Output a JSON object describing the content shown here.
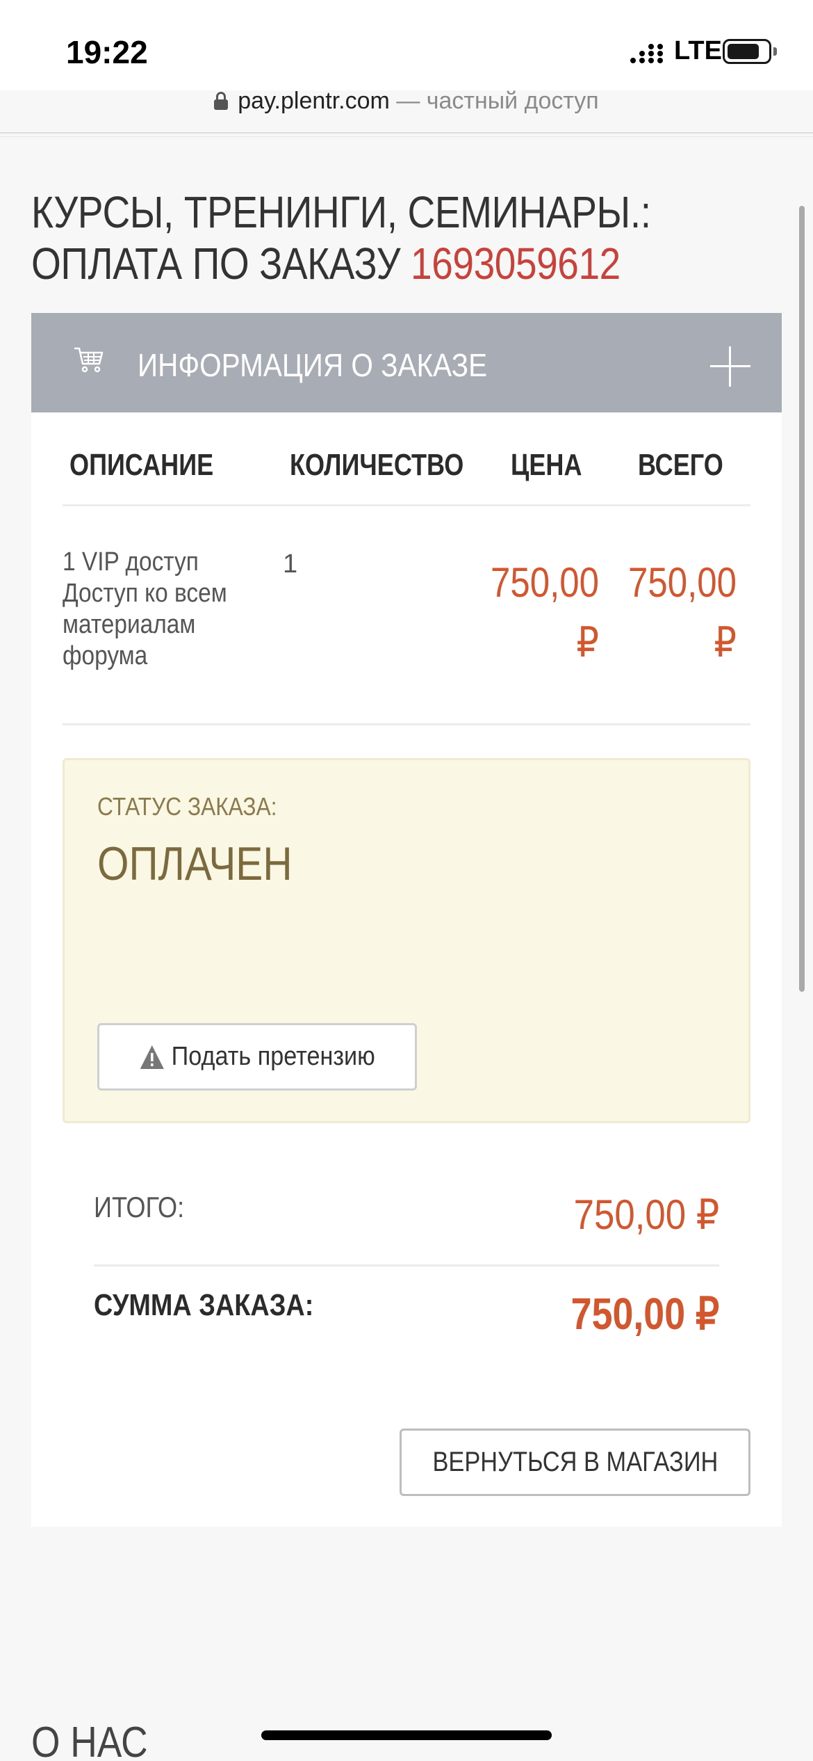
{
  "status_bar": {
    "time": "19:22",
    "network": "LTE",
    "battery_level": 0.8
  },
  "browser": {
    "domain": "pay.plentr.com",
    "privacy": "— частный доступ"
  },
  "page": {
    "title_line1": "КУРСЫ, ТРЕНИНГИ, СЕМИНАРЫ.:",
    "title_line2_prefix": "ОПЛАТА ПО ЗАКАЗУ ",
    "order_number": "1693059612"
  },
  "order_info": {
    "header": "ИНФОРМАЦИЯ О ЗАКАЗЕ",
    "columns": {
      "description": "ОПИСАНИЕ",
      "quantity": "КОЛИЧЕСТВО",
      "price": "ЦЕНА",
      "total": "ВСЕГО"
    },
    "item": {
      "description": "1 VIP доступ Доступ ко всем материалам форума",
      "quantity": "1",
      "price": "750,00 ₽",
      "total": "750,00 ₽"
    }
  },
  "status": {
    "label": "СТАТУС ЗАКАЗА:",
    "value": "ОПЛАЧЕН",
    "claim_button": "Подать претензию"
  },
  "totals": {
    "subtotal_label": "ИТОГО:",
    "subtotal_value": "750,00 ₽",
    "sum_label": "СУММА ЗАКАЗА:",
    "sum_value": "750,00 ₽"
  },
  "back_button": "ВЕРНУТЬСЯ В МАГАЗИН",
  "footer": {
    "heading": "О НАС"
  },
  "colors": {
    "accent": "#d2562e",
    "order_number": "#c7423a",
    "header_bg": "#a8adb5",
    "status_bg": "#faf7e4"
  }
}
